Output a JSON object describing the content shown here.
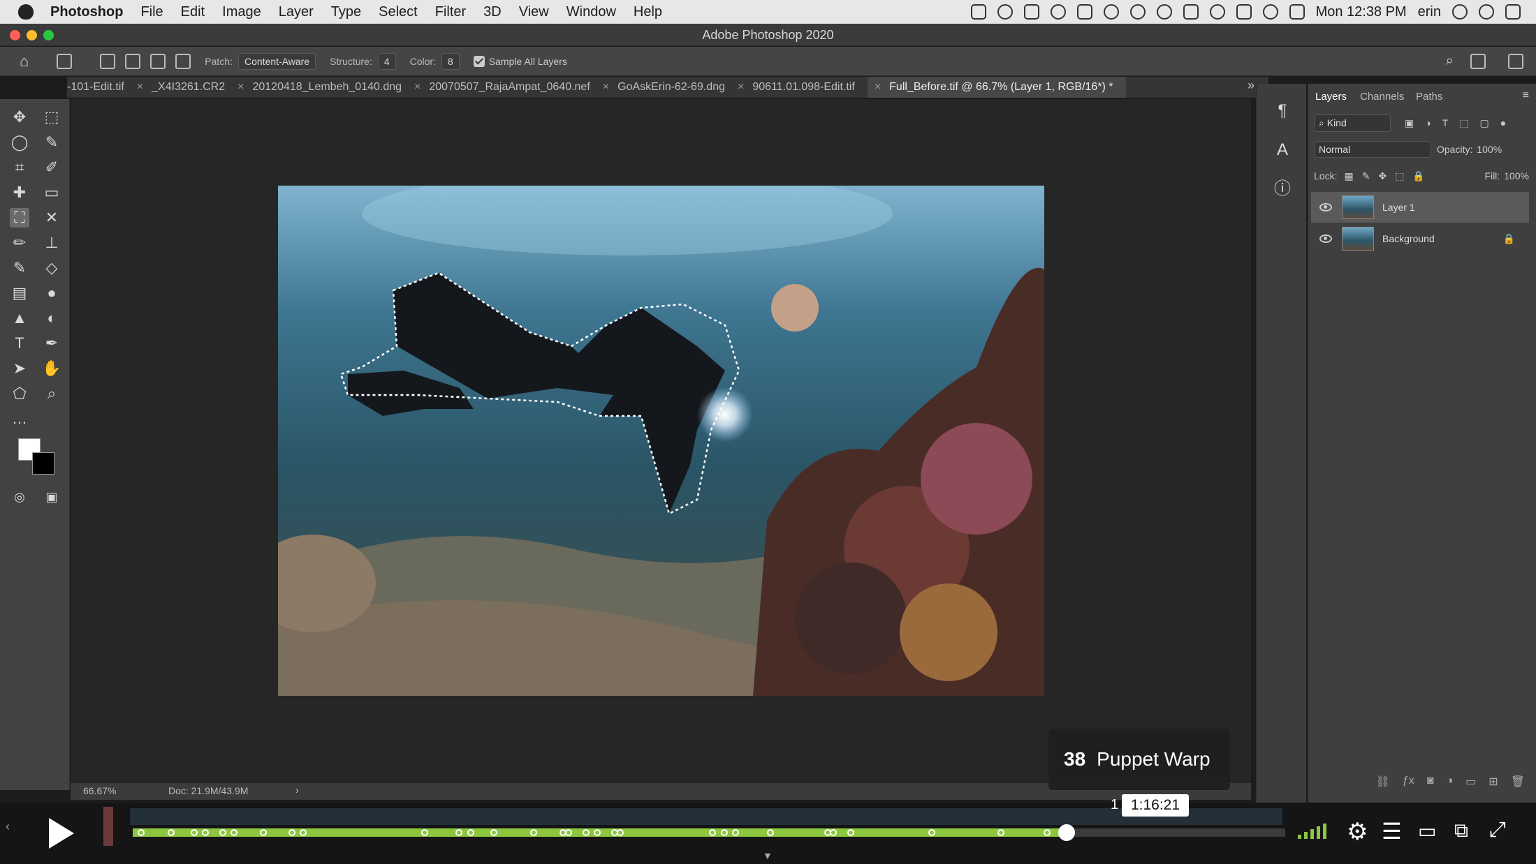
{
  "menubar": {
    "app_name": "Photoshop",
    "items": [
      "File",
      "Edit",
      "Image",
      "Layer",
      "Type",
      "Select",
      "Filter",
      "3D",
      "View",
      "Window",
      "Help"
    ],
    "clock": "Mon 12:38 PM",
    "user": "erin"
  },
  "window": {
    "title": "Adobe Photoshop 2020"
  },
  "options": {
    "patch_label": "Patch:",
    "patch_value": "Content-Aware",
    "structure_label": "Structure:",
    "structure_value": "4",
    "color_label": "Color:",
    "color_value": "8",
    "sample_all_layers": "Sample All Layers"
  },
  "tabs": [
    {
      "label": "-101-Edit.tif"
    },
    {
      "label": "_X4I3261.CR2"
    },
    {
      "label": "20120418_Lembeh_0140.dng"
    },
    {
      "label": "20070507_RajaAmpat_0640.nef"
    },
    {
      "label": "GoAskErin-62-69.dng"
    },
    {
      "label": "90611.01.098-Edit.tif"
    },
    {
      "label": "Full_Before.tif @ 66.7% (Layer 1, RGB/16*) *"
    }
  ],
  "status": {
    "zoom": "66.67%",
    "doc": "Doc: 21.9M/43.9M"
  },
  "panel": {
    "tabs": [
      "Layers",
      "Channels",
      "Paths"
    ],
    "kind": "Kind",
    "blend_mode": "Normal",
    "opacity_label": "Opacity:",
    "opacity": "100%",
    "lock_label": "Lock:",
    "fill_label": "Fill:",
    "fill": "100%",
    "layers": [
      {
        "name": "Layer 1",
        "selected": true
      },
      {
        "name": "Background",
        "locked": true
      }
    ]
  },
  "video": {
    "chapter_number": "38",
    "chapter_title": "Puppet Warp",
    "time": "1:16:21",
    "progress": 0.81,
    "accent": "#8dc63f",
    "chapter_marker_label": "1"
  },
  "icons": {
    "tools": [
      "move-icon",
      "marquee-icon",
      "lasso-icon",
      "quick-select-icon",
      "crop-icon",
      "eyedropper-icon",
      "healing-icon",
      "ruler-icon",
      "patch-icon",
      "content-aware-move-icon",
      "brush-icon",
      "stamp-icon",
      "history-brush-icon",
      "eraser-icon",
      "gradient-icon",
      "blur-icon",
      "sharpen-icon",
      "dodge-icon",
      "type-icon",
      "pen-icon",
      "path-select-icon",
      "hand-icon",
      "shape-icon",
      "zoom-icon",
      "more-icon"
    ]
  }
}
